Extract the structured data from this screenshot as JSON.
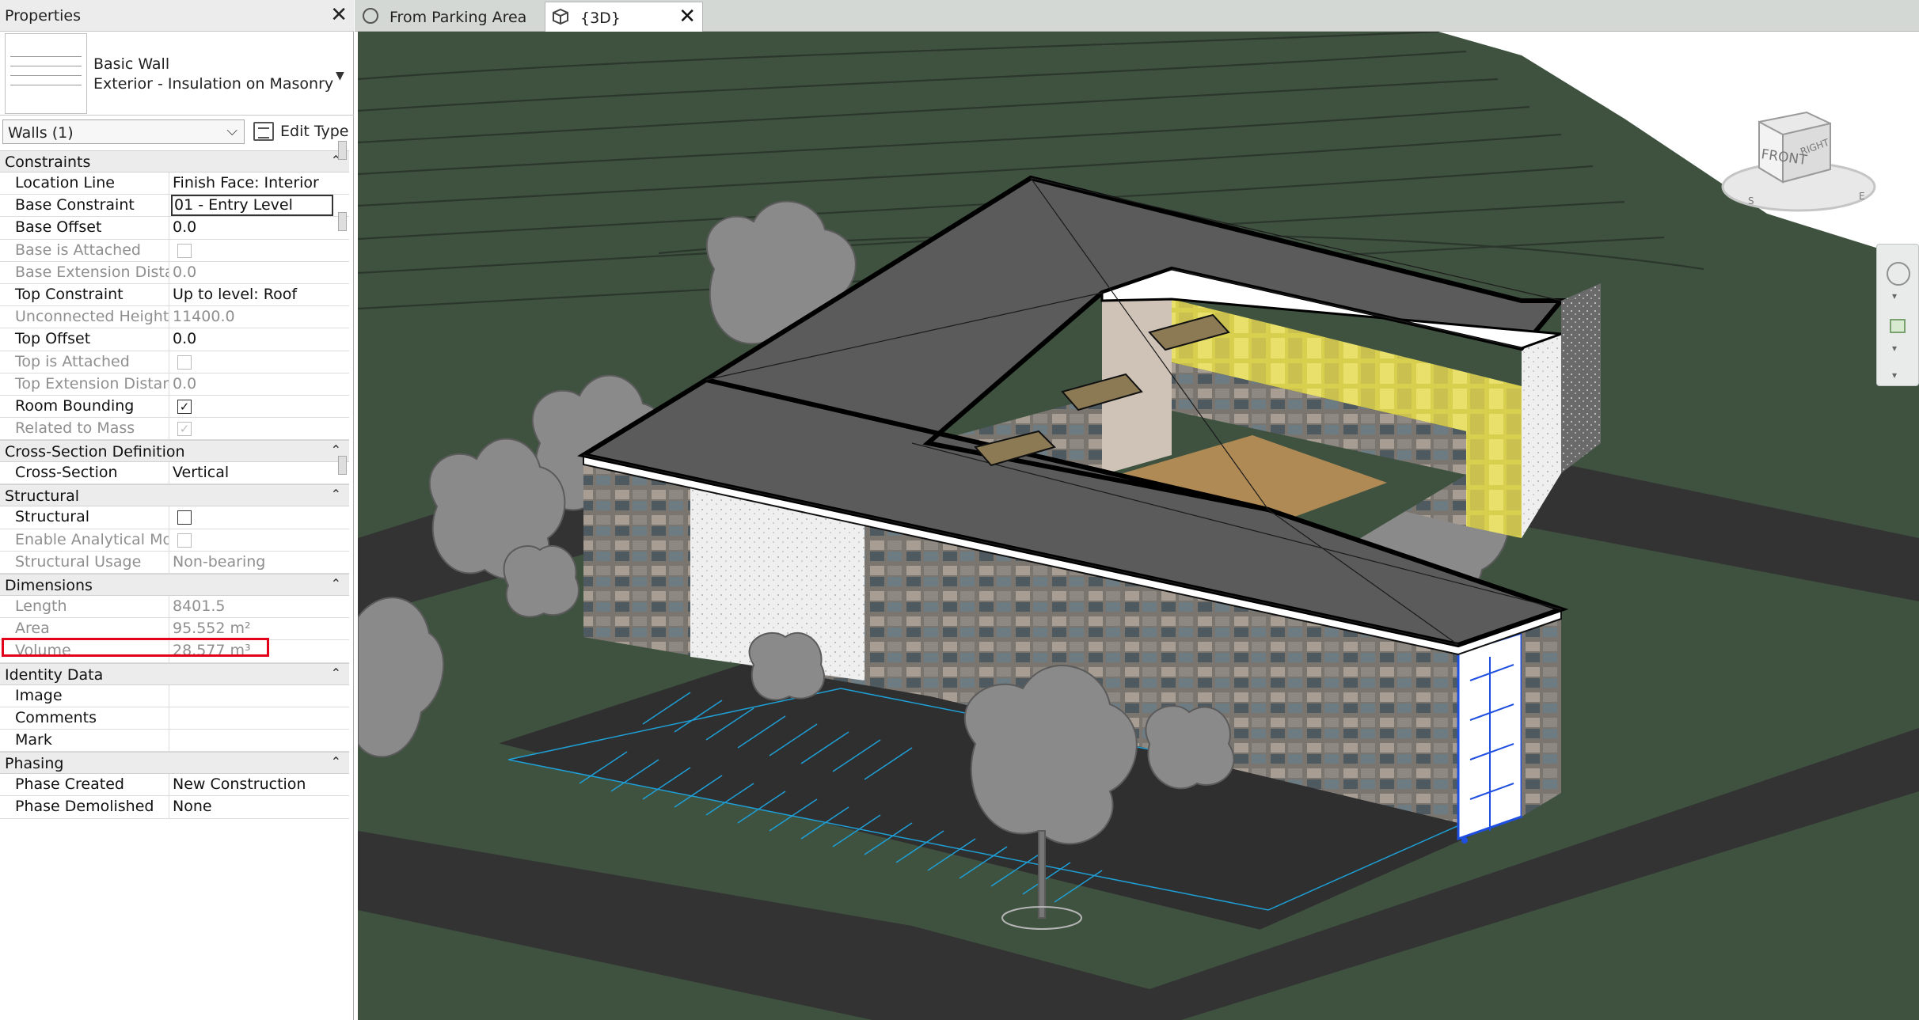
{
  "properties": {
    "title": "Properties",
    "type_family": "Basic Wall",
    "type_name": "Exterior - Insulation on Masonry",
    "filter": "Walls (1)",
    "edit_type": "Edit Type",
    "groups": [
      {
        "name": "Constraints",
        "rows": [
          {
            "name": "Location Line",
            "value": "Finish Face: Interior"
          },
          {
            "name": "Base Constraint",
            "value": "01 - Entry Level",
            "editing": true
          },
          {
            "name": "Base Offset",
            "value": "0.0"
          },
          {
            "name": "Base is Attached",
            "value": "",
            "checkbox": false,
            "readonly": true
          },
          {
            "name": "Base Extension Dista...",
            "value": "0.0",
            "readonly": true
          },
          {
            "name": "Top Constraint",
            "value": "Up to level: Roof"
          },
          {
            "name": "Unconnected Height",
            "value": "11400.0",
            "readonly": true
          },
          {
            "name": "Top Offset",
            "value": "0.0"
          },
          {
            "name": "Top is Attached",
            "value": "",
            "checkbox": false,
            "readonly": true
          },
          {
            "name": "Top Extension Distance",
            "value": "0.0",
            "readonly": true
          },
          {
            "name": "Room Bounding",
            "value": "",
            "checkbox": true
          },
          {
            "name": "Related to Mass",
            "value": "",
            "checkbox": true,
            "readonly": true
          }
        ]
      },
      {
        "name": "Cross-Section Definition",
        "rows": [
          {
            "name": "Cross-Section",
            "value": "Vertical"
          }
        ]
      },
      {
        "name": "Structural",
        "rows": [
          {
            "name": "Structural",
            "value": "",
            "checkbox": false
          },
          {
            "name": "Enable Analytical Mo...",
            "value": "",
            "checkbox": false,
            "readonly": true
          },
          {
            "name": "Structural Usage",
            "value": "Non-bearing",
            "readonly": true
          }
        ]
      },
      {
        "name": "Dimensions",
        "rows": [
          {
            "name": "Length",
            "value": "8401.5",
            "readonly": true
          },
          {
            "name": "Area",
            "value": "95.552 m²",
            "readonly": true
          },
          {
            "name": "Volume",
            "value": "28.577 m³",
            "readonly": true
          }
        ]
      },
      {
        "name": "Identity Data",
        "rows": [
          {
            "name": "Image",
            "value": ""
          },
          {
            "name": "Comments",
            "value": ""
          },
          {
            "name": "Mark",
            "value": ""
          }
        ]
      },
      {
        "name": "Phasing",
        "rows": [
          {
            "name": "Phase Created",
            "value": "New Construction"
          },
          {
            "name": "Phase Demolished",
            "value": "None"
          }
        ]
      }
    ]
  },
  "tabs": [
    {
      "label": "From Parking Area",
      "active": false
    },
    {
      "label": "{3D}",
      "active": true
    }
  ],
  "viewcube": {
    "front": "FRONT",
    "right": "RIGHT"
  },
  "colors": {
    "grass": "#3f5240",
    "road": "#3a3a3a",
    "roof": "#5a5a5a",
    "selection": "#1f4fe0",
    "highlight": "#e3001b"
  }
}
